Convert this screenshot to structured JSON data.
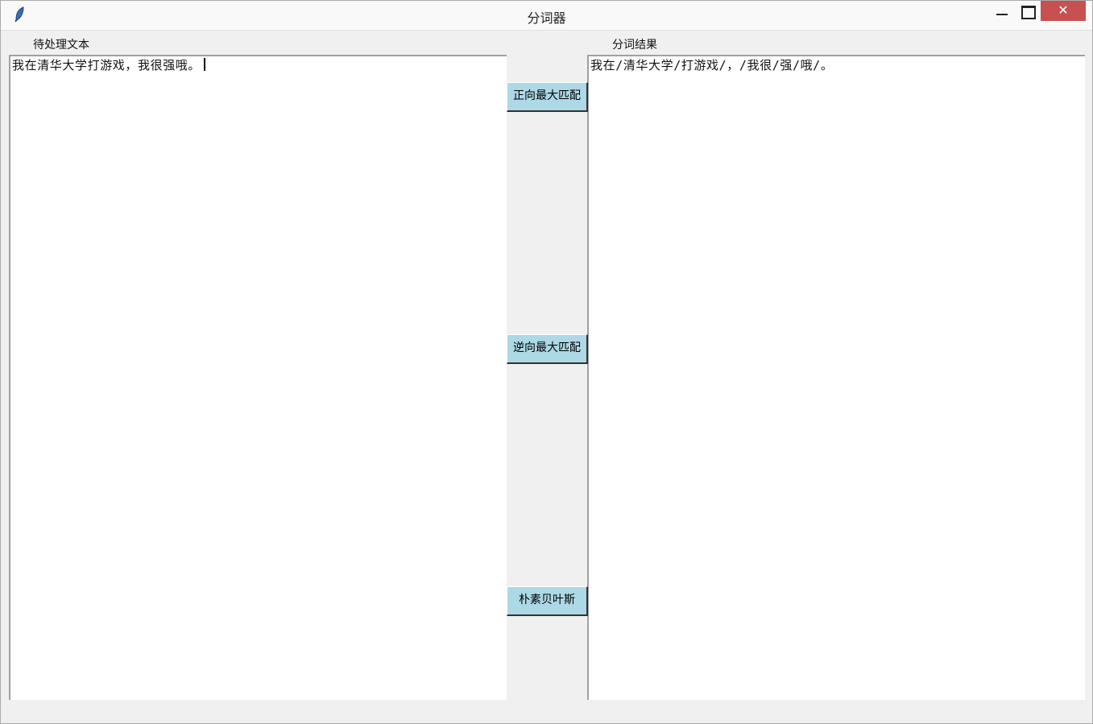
{
  "window": {
    "title": "分词器"
  },
  "input": {
    "label": "待处理文本",
    "value": "我在清华大学打游戏，我很强哦。"
  },
  "output": {
    "label": "分词结果",
    "value": "我在/清华大学/打游戏/，/我很/强/哦/。"
  },
  "buttons": {
    "forward": "正向最大匹配",
    "backward": "逆向最大匹配",
    "bayes": "朴素贝叶斯"
  },
  "controls": {
    "close": "✕"
  }
}
